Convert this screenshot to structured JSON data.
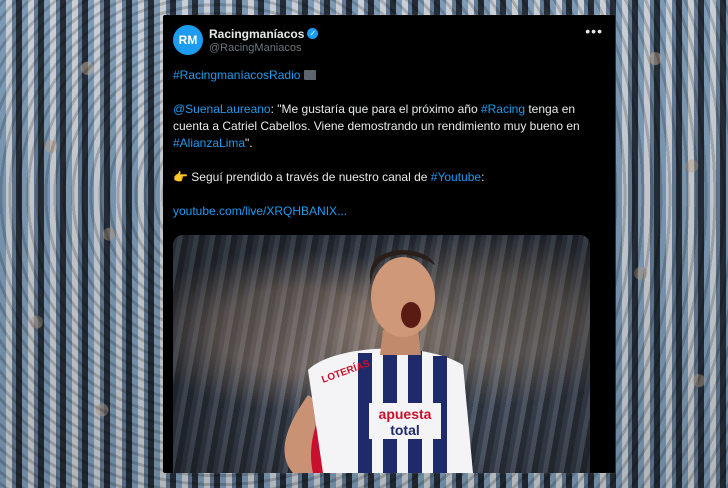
{
  "tweet": {
    "avatar_text": "RM",
    "display_name": "Racingmaníacos",
    "handle": "@RacingManiacos",
    "more_label": "•••",
    "line1_hashtag": "#RacingmaníacosRadio",
    "p2_mention": "@SuenaLaureano",
    "p2_text_a": ": \"Me gustaría que para el próximo año ",
    "p2_tag_racing": "#Racing",
    "p2_text_b": " tenga en cuenta a Catriel Cabellos. Viene demostrando un rendimiento muy bueno en ",
    "p2_tag_alianza": "#AlianzaLima",
    "p2_text_c": "\".",
    "p3_emoji": "👉",
    "p3_text": " Seguí prendido a través de nuestro canal de ",
    "p3_tag": "#Youtube",
    "p3_colon": ":",
    "link": "youtube.com/live/XRQHBANIX..."
  },
  "photo": {
    "sponsor_left": "LOTERÍAS",
    "sponsor_chest": "apuesta",
    "sponsor_chest2": "total"
  },
  "colors": {
    "accent": "#1d9bf0",
    "card_bg": "#000000",
    "text": "#e7e9ea",
    "muted": "#71767b"
  }
}
